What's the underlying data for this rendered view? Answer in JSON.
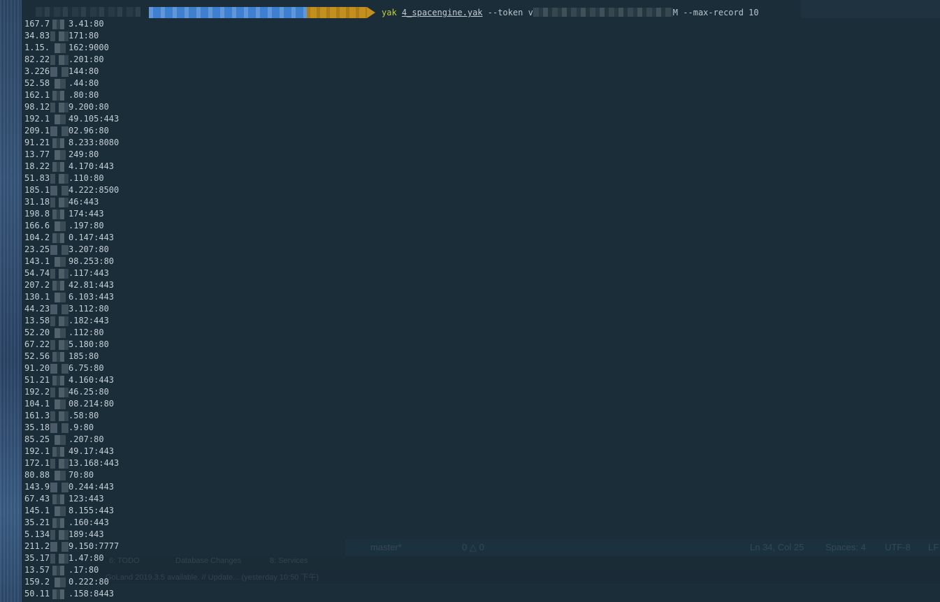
{
  "prompt": {
    "command_exe": "yak",
    "command_file": "4_spacengine.yak",
    "command_flag_token": "--token",
    "command_token_start": "v",
    "command_token_end": "M",
    "command_rest": "--max-record 10"
  },
  "output_lines": [
    {
      "prefix": "167.7",
      "suffix": "3.41:80"
    },
    {
      "prefix": "34.83",
      "suffix": "171:80"
    },
    {
      "prefix": "1.15.",
      "suffix": "162:9000"
    },
    {
      "prefix": "82.22",
      "suffix": ".201:80"
    },
    {
      "prefix": "3.226",
      "suffix": "144:80"
    },
    {
      "prefix": "52.58",
      "suffix": ".44:80"
    },
    {
      "prefix": "162.1",
      "suffix": ".80:80"
    },
    {
      "prefix": "98.12",
      "suffix": "9.200:80"
    },
    {
      "prefix": "192.1",
      "suffix": "49.105:443"
    },
    {
      "prefix": "209.1",
      "suffix": "02.96:80"
    },
    {
      "prefix": "91.21",
      "suffix": "8.233:8080"
    },
    {
      "prefix": "13.77",
      "suffix": "249:80"
    },
    {
      "prefix": "18.22",
      "suffix": "4.170:443"
    },
    {
      "prefix": "51.83",
      "suffix": ".110:80"
    },
    {
      "prefix": "185.1",
      "suffix": "4.222:8500"
    },
    {
      "prefix": "31.18",
      "suffix": "46:443"
    },
    {
      "prefix": "198.8",
      "suffix": "174:443"
    },
    {
      "prefix": "166.6",
      "suffix": ".197:80"
    },
    {
      "prefix": "104.2",
      "suffix": "0.147:443"
    },
    {
      "prefix": "23.25",
      "suffix": "3.207:80"
    },
    {
      "prefix": "143.1",
      "suffix": "98.253:80"
    },
    {
      "prefix": "54.74",
      "suffix": ".117:443"
    },
    {
      "prefix": "207.2",
      "suffix": "42.81:443"
    },
    {
      "prefix": "130.1",
      "suffix": "6.103:443"
    },
    {
      "prefix": "44.23",
      "suffix": "3.112:80"
    },
    {
      "prefix": "13.58",
      "suffix": ".182:443"
    },
    {
      "prefix": "52.20",
      "suffix": ".112:80"
    },
    {
      "prefix": "67.22",
      "suffix": "5.180:80"
    },
    {
      "prefix": "52.56",
      "suffix": "185:80"
    },
    {
      "prefix": "91.20",
      "suffix": "6.75:80"
    },
    {
      "prefix": "51.21",
      "suffix": "4.160:443"
    },
    {
      "prefix": "192.2",
      "suffix": "46.25:80"
    },
    {
      "prefix": "104.1",
      "suffix": "08.214:80"
    },
    {
      "prefix": "161.3",
      "suffix": ".58:80"
    },
    {
      "prefix": "35.18",
      "suffix": ".9:80"
    },
    {
      "prefix": "85.25",
      "suffix": ".207:80"
    },
    {
      "prefix": "192.1",
      "suffix": "49.17:443"
    },
    {
      "prefix": "172.1",
      "suffix": "13.168:443"
    },
    {
      "prefix": "80.88",
      "suffix": "70:80"
    },
    {
      "prefix": "143.9",
      "suffix": "0.244:443"
    },
    {
      "prefix": "67.43",
      "suffix": "123:443"
    },
    {
      "prefix": "145.1",
      "suffix": "8.155:443"
    },
    {
      "prefix": "35.21",
      "suffix": ".160:443"
    },
    {
      "prefix": "5.134",
      "suffix": "189:443"
    },
    {
      "prefix": "211.2",
      "suffix": "9.150:7777"
    },
    {
      "prefix": "35.17",
      "suffix": "1.47:80"
    },
    {
      "prefix": "13.57",
      "suffix": ".17:80"
    },
    {
      "prefix": "159.2",
      "suffix": "0.222:80"
    },
    {
      "prefix": "50.11",
      "suffix": ".158:8443"
    }
  ],
  "background_ghost": {
    "status_branch": "master*",
    "status_counts": "0 △ 0",
    "status_position": "Ln 34, Col 25",
    "status_spaces": "Spaces: 4",
    "status_encoding": "UTF-8",
    "status_lf": "LF",
    "tool_todo": "6: TODO",
    "tool_db": "Database Changes",
    "tool_services": "8: Services",
    "notice": "GoLand 2019.3.5 available. // Update... (yesterday 10:50 下午)"
  },
  "colors": {
    "terminal_bg": "#1b2d39",
    "text": "#c4cfd6",
    "dir_segment": "#3e7fd0",
    "git_segment": "#c3901d",
    "command_exe": "#c5cd3c"
  }
}
